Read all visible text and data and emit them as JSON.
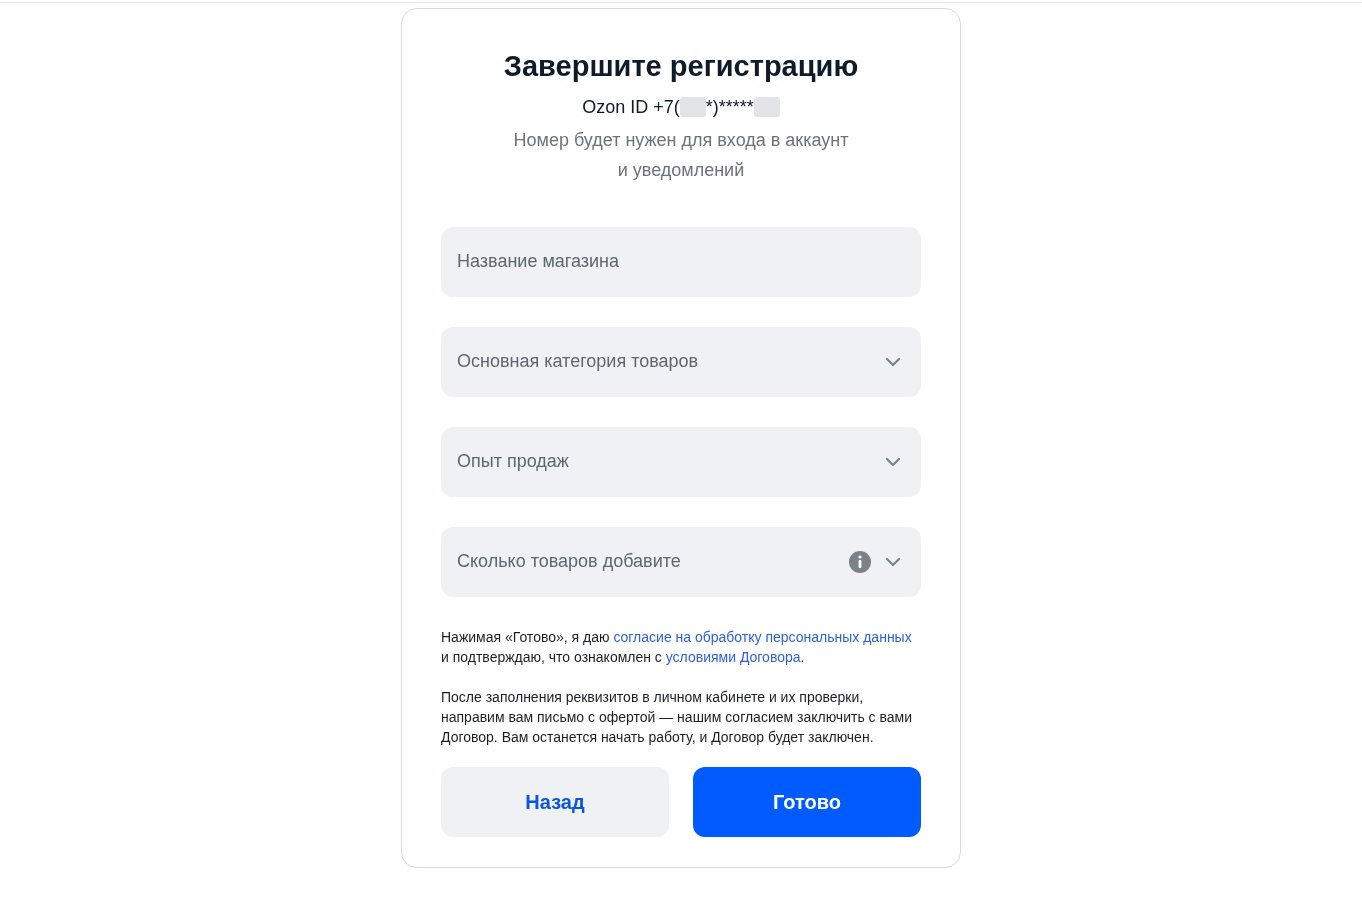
{
  "title": "Завершите регистрацию",
  "account": [
    {
      "kind": "text",
      "text": "Ozon ID +7("
    },
    {
      "kind": "redacted"
    },
    {
      "kind": "text",
      "text": "*)*****"
    },
    {
      "kind": "redacted"
    }
  ],
  "subtitle": "Номер будет нужен для входа в аккаунт и уведомлений",
  "fields": [
    {
      "kind": "text",
      "placeholder": "Название магазина",
      "info": false
    },
    {
      "kind": "select",
      "placeholder": "Основная категория товаров",
      "info": false
    },
    {
      "kind": "select",
      "placeholder": "Опыт продаж",
      "info": false
    },
    {
      "kind": "select",
      "placeholder": "Сколько товаров добавите",
      "info": true
    }
  ],
  "consent": [
    {
      "kind": "text",
      "text": "Нажимая «Готово», я даю "
    },
    {
      "kind": "link",
      "text": "согласие на обработку персональных данных"
    },
    {
      "kind": "text",
      "text": " и подтверждаю, что ознакомлен с "
    },
    {
      "kind": "link",
      "text": "условиями Договора"
    },
    {
      "kind": "text",
      "text": "."
    }
  ],
  "note": "После заполнения реквизитов в личном кабинете и их проверки, направим вам письмо с офертой — нашим согласием заключить с вами Договор. Вам останется начать работу, и Договор будет заключен.",
  "buttons": [
    {
      "kind": "secondary",
      "label": "Назад"
    },
    {
      "kind": "primary",
      "label": "Готово"
    }
  ]
}
